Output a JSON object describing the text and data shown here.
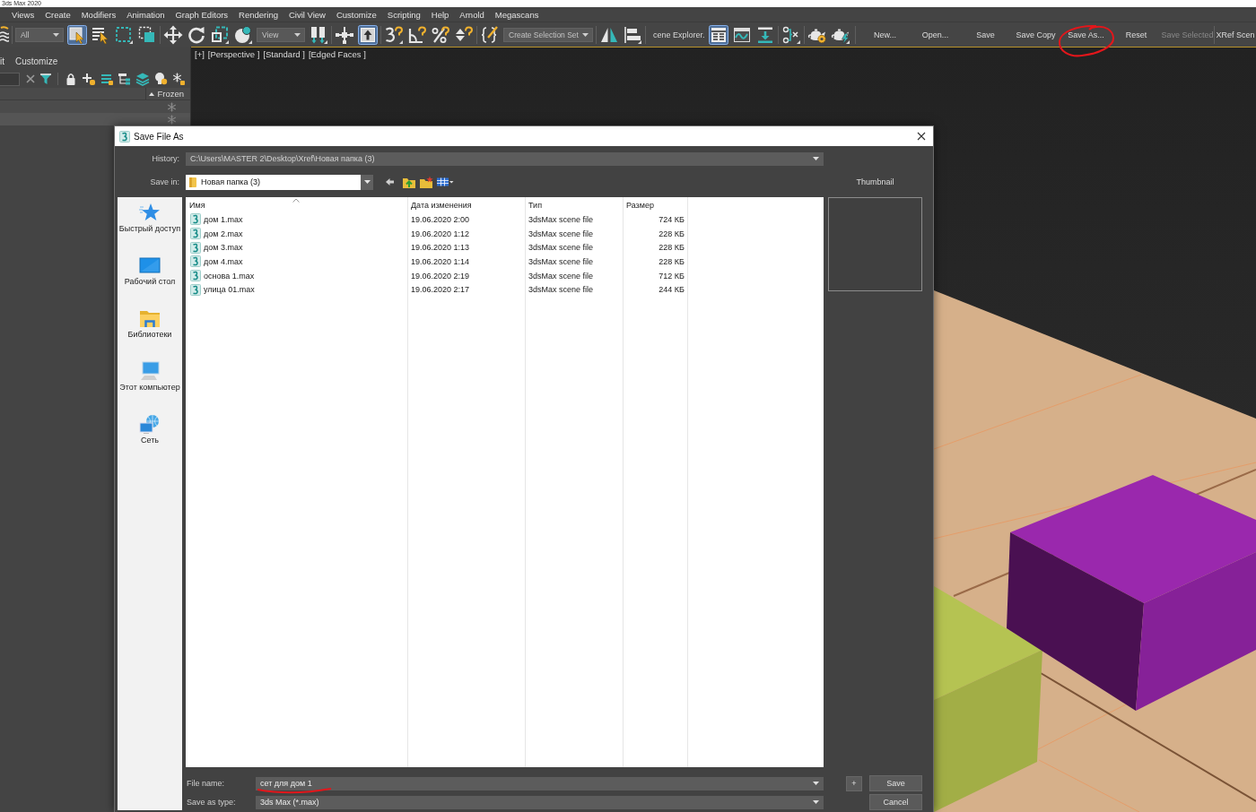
{
  "window": {
    "title": "3ds Max 2020"
  },
  "menu": [
    "Views",
    "Create",
    "Modifiers",
    "Animation",
    "Graph Editors",
    "Rendering",
    "Civil View",
    "Customize",
    "Scripting",
    "Help",
    "Arnold",
    "Megascans"
  ],
  "toolbar": {
    "groups": [
      {
        "items": [
          {
            "kind": "layers",
            "selected": false
          }
        ]
      },
      {
        "items": [
          {
            "kind": "dropdown",
            "label": "All"
          },
          {
            "kind": "select",
            "selected": true
          },
          {
            "kind": "select-by-name",
            "selected": false
          },
          {
            "kind": "region",
            "selected": false
          },
          {
            "kind": "crossing",
            "selected": false
          }
        ]
      },
      {
        "items": [
          {
            "kind": "move",
            "selected": false
          },
          {
            "kind": "rotate",
            "selected": false
          },
          {
            "kind": "scale",
            "selected": false
          },
          {
            "kind": "place",
            "selected": false
          },
          {
            "kind": "dropdown",
            "label": "View"
          },
          {
            "kind": "pivot",
            "selected": false
          }
        ]
      },
      {
        "items": [
          {
            "kind": "crosshair",
            "selected": false
          },
          {
            "kind": "manipulate",
            "selected": true
          }
        ]
      },
      {
        "items": [
          {
            "kind": "snap3",
            "selected": false
          },
          {
            "kind": "angle",
            "selected": false
          },
          {
            "kind": "percent",
            "selected": false
          },
          {
            "kind": "spinner",
            "selected": false
          }
        ]
      },
      {
        "items": [
          {
            "kind": "braces",
            "selected": false
          },
          {
            "kind": "dropdown",
            "label": "Create Selection Set"
          }
        ]
      },
      {
        "items": [
          {
            "kind": "mirror",
            "selected": false
          },
          {
            "kind": "align",
            "selected": false
          }
        ]
      },
      {
        "items": [
          {
            "kind": "text",
            "label": "cene Explorer."
          },
          {
            "kind": "explorer",
            "selected": true
          },
          {
            "kind": "curve",
            "selected": false
          },
          {
            "kind": "download",
            "selected": false
          }
        ]
      },
      {
        "items": [
          {
            "kind": "schematic",
            "selected": false
          }
        ]
      },
      {
        "items": [
          {
            "kind": "render-setup",
            "selected": false
          },
          {
            "kind": "render",
            "selected": false
          }
        ]
      },
      {
        "items": [
          {
            "kind": "button",
            "label": "New...",
            "disabled": false
          },
          {
            "kind": "button",
            "label": "Open...",
            "disabled": false
          },
          {
            "kind": "button",
            "label": "Save",
            "disabled": false
          },
          {
            "kind": "button",
            "label": "Save Copy",
            "disabled": false
          },
          {
            "kind": "button",
            "label": "Save As...",
            "disabled": false
          },
          {
            "kind": "button",
            "label": "Reset",
            "disabled": false
          },
          {
            "kind": "button",
            "label": "Save Selected",
            "disabled": true
          }
        ]
      },
      {
        "items": [
          {
            "kind": "button",
            "label": "XRef Scen",
            "disabled": false
          }
        ]
      }
    ]
  },
  "explorer": {
    "menu": [
      "it",
      "Customize"
    ],
    "column": "Frozen",
    "rows": [
      {
        "frozen": false
      },
      {
        "frozen": false
      }
    ]
  },
  "viewport": {
    "labels": [
      "[+]",
      "[Perspective ]",
      "[Standard ]",
      "[Edged Faces ]"
    ]
  },
  "dialog": {
    "title": "Save File As",
    "history": {
      "label": "History:",
      "value": "C:\\Users\\MASTER 2\\Desktop\\Xref\\Новая папка (3)"
    },
    "save_in": {
      "label": "Save in:",
      "value": "Новая папка (3)"
    },
    "thumbnail": {
      "label": "Thumbnail"
    },
    "places": [
      {
        "kind": "quick-access",
        "label": "Быстрый доступ"
      },
      {
        "kind": "desktop",
        "label": "Рабочий стол"
      },
      {
        "kind": "libraries",
        "label": "Библиотеки"
      },
      {
        "kind": "computer",
        "label": "Этот компьютер"
      },
      {
        "kind": "network",
        "label": "Сеть"
      }
    ],
    "columns": [
      {
        "label": "Имя",
        "sorted": true
      },
      {
        "label": "Дата изменения",
        "sorted": false
      },
      {
        "label": "Тип",
        "sorted": false
      },
      {
        "label": "Размер",
        "sorted": false
      }
    ],
    "files": [
      {
        "name": "дом 1.max",
        "modified": "19.06.2020 2:00",
        "type": "3dsMax scene file",
        "size": "724 КБ"
      },
      {
        "name": "дом 2.max",
        "modified": "19.06.2020 1:12",
        "type": "3dsMax scene file",
        "size": "228 КБ"
      },
      {
        "name": "дом 3.max",
        "modified": "19.06.2020 1:13",
        "type": "3dsMax scene file",
        "size": "228 КБ"
      },
      {
        "name": "дом 4.max",
        "modified": "19.06.2020 1:14",
        "type": "3dsMax scene file",
        "size": "228 КБ"
      },
      {
        "name": "основа 1.max",
        "modified": "19.06.2020 2:19",
        "type": "3dsMax scene file",
        "size": "712 КБ"
      },
      {
        "name": "улица 01.max",
        "modified": "19.06.2020 2:17",
        "type": "3dsMax scene file",
        "size": "244 КБ"
      }
    ],
    "file_name": {
      "label": "File name:",
      "value": "сет для дом 1"
    },
    "save_as_type": {
      "label": "Save as type:",
      "value": "3ds Max (*.max)"
    },
    "plus_button": "+",
    "buttons": [
      "Save",
      "Cancel"
    ]
  }
}
